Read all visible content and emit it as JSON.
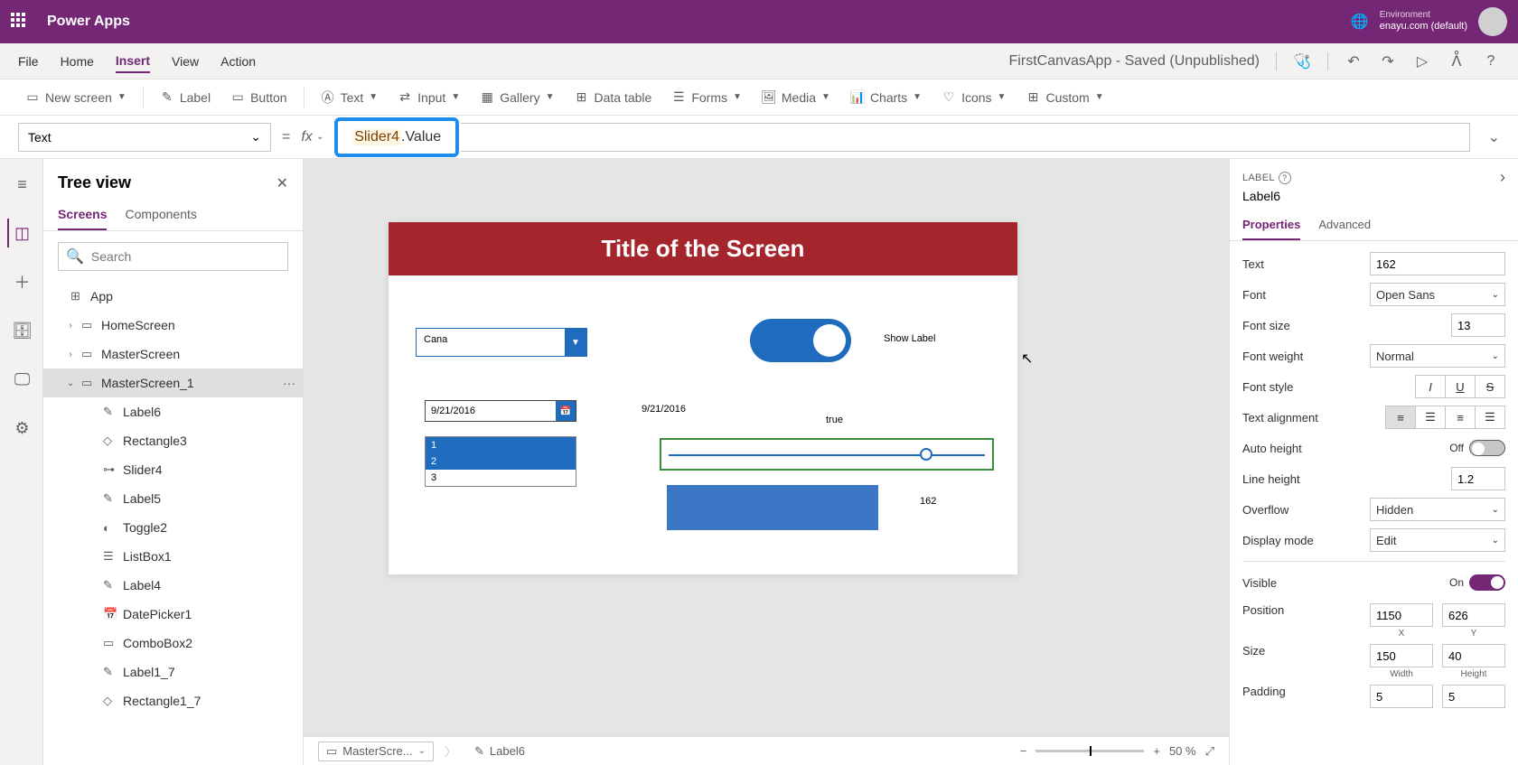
{
  "header": {
    "app_title": "Power Apps",
    "env_label": "Environment",
    "env_name": "enayu.com (default)"
  },
  "menubar": {
    "items": [
      "File",
      "Home",
      "Insert",
      "View",
      "Action"
    ],
    "active": "Insert",
    "status": "FirstCanvasApp - Saved (Unpublished)"
  },
  "toolbar": {
    "new_screen": "New screen",
    "label": "Label",
    "button": "Button",
    "text": "Text",
    "input": "Input",
    "gallery": "Gallery",
    "data_table": "Data table",
    "forms": "Forms",
    "media": "Media",
    "charts": "Charts",
    "icons": "Icons",
    "custom": "Custom"
  },
  "formula": {
    "property": "Text",
    "expr_ident": "Slider4",
    "expr_prop": ".Value"
  },
  "tree": {
    "title": "Tree view",
    "tabs": {
      "screens": "Screens",
      "components": "Components"
    },
    "search_placeholder": "Search",
    "items": [
      {
        "label": "App",
        "depth": 0,
        "icon": "⊞"
      },
      {
        "label": "HomeScreen",
        "depth": 1,
        "exp": "›",
        "icon": "▭"
      },
      {
        "label": "MasterScreen",
        "depth": 1,
        "exp": "›",
        "icon": "▭"
      },
      {
        "label": "MasterScreen_1",
        "depth": 1,
        "exp": "⌄",
        "icon": "▭",
        "sel": true,
        "dots": "···"
      },
      {
        "label": "Label6",
        "depth": 2,
        "icon": "✎"
      },
      {
        "label": "Rectangle3",
        "depth": 2,
        "icon": "◇"
      },
      {
        "label": "Slider4",
        "depth": 2,
        "icon": "⊶"
      },
      {
        "label": "Label5",
        "depth": 2,
        "icon": "✎"
      },
      {
        "label": "Toggle2",
        "depth": 2,
        "icon": "◐"
      },
      {
        "label": "ListBox1",
        "depth": 2,
        "icon": "☰"
      },
      {
        "label": "Label4",
        "depth": 2,
        "icon": "✎"
      },
      {
        "label": "DatePicker1",
        "depth": 2,
        "icon": "📅"
      },
      {
        "label": "ComboBox2",
        "depth": 2,
        "icon": "▭"
      },
      {
        "label": "Label1_7",
        "depth": 2,
        "icon": "✎"
      },
      {
        "label": "Rectangle1_7",
        "depth": 2,
        "icon": "◇"
      }
    ]
  },
  "canvas": {
    "title": "Title of the Screen",
    "combo_value": "Cana",
    "toggle_label": "Show Label",
    "date_value": "9/21/2016",
    "date_label": "9/21/2016",
    "true_label": "true",
    "list": [
      "1",
      "2",
      "3"
    ],
    "value_label": "162"
  },
  "footer": {
    "breadcrumb_screen": "MasterScre...",
    "breadcrumb_control": "Label6",
    "zoom": "50 %"
  },
  "props": {
    "type": "LABEL",
    "name": "Label6",
    "tabs": {
      "properties": "Properties",
      "advanced": "Advanced"
    },
    "rows": {
      "text_lbl": "Text",
      "text_val": "162",
      "font_lbl": "Font",
      "font_val": "Open Sans",
      "fontsize_lbl": "Font size",
      "fontsize_val": "13",
      "fontweight_lbl": "Font weight",
      "fontweight_val": "Normal",
      "fontstyle_lbl": "Font style",
      "align_lbl": "Text alignment",
      "autoh_lbl": "Auto height",
      "autoh_state": "Off",
      "lineh_lbl": "Line height",
      "lineh_val": "1.2",
      "overflow_lbl": "Overflow",
      "overflow_val": "Hidden",
      "dispmode_lbl": "Display mode",
      "dispmode_val": "Edit",
      "visible_lbl": "Visible",
      "visible_state": "On",
      "position_lbl": "Position",
      "pos_x": "1150",
      "pos_y": "626",
      "pos_xl": "X",
      "pos_yl": "Y",
      "size_lbl": "Size",
      "size_w": "150",
      "size_h": "40",
      "size_wl": "Width",
      "size_hl": "Height",
      "padding_lbl": "Padding",
      "pad_t": "5",
      "pad_r": "5"
    }
  }
}
